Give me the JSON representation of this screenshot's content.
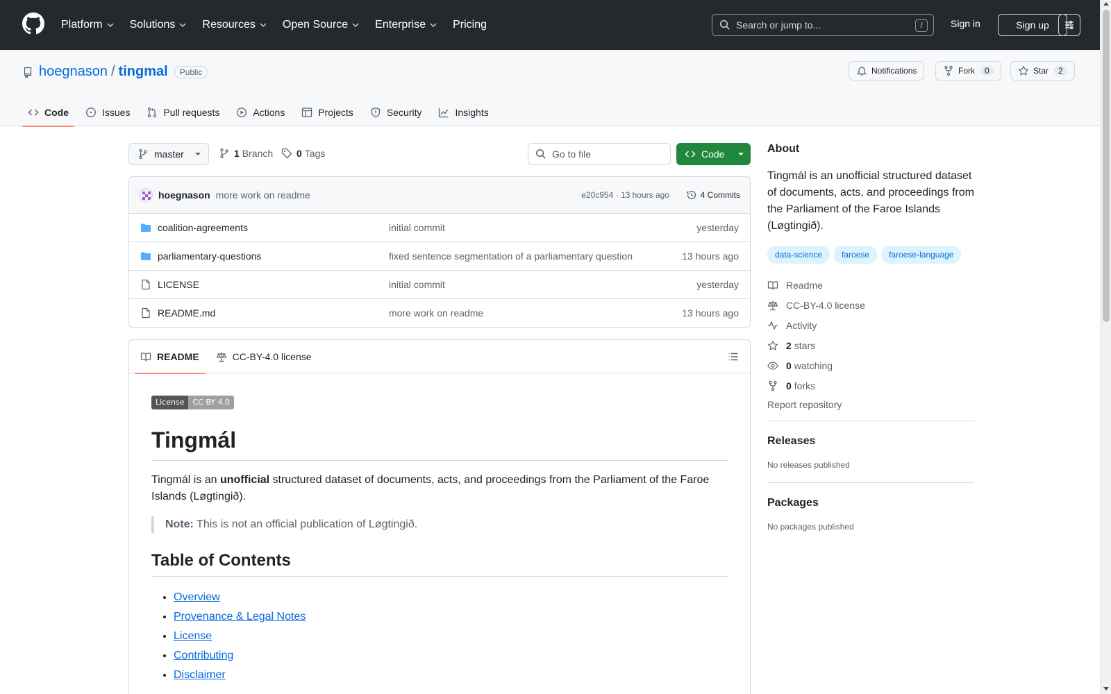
{
  "header": {
    "nav": [
      "Platform",
      "Solutions",
      "Resources",
      "Open Source",
      "Enterprise",
      "Pricing"
    ],
    "search_placeholder": "Search or jump to...",
    "search_shortcut": "/",
    "sign_in": "Sign in",
    "sign_up": "Sign up"
  },
  "repo": {
    "owner": "hoegnason",
    "name": "tingmal",
    "visibility": "Public",
    "notifications_label": "Notifications",
    "fork_label": "Fork",
    "fork_count": "0",
    "star_label": "Star",
    "star_count": "2"
  },
  "tabs": [
    "Code",
    "Issues",
    "Pull requests",
    "Actions",
    "Projects",
    "Security",
    "Insights"
  ],
  "toolbar": {
    "branch": "master",
    "branch_count": "1",
    "branch_label": "Branch",
    "tag_count": "0",
    "tag_label": "Tags",
    "go_to_file": "Go to file",
    "code_button": "Code"
  },
  "commit": {
    "author": "hoegnason",
    "message": "more work on readme",
    "hash_time": "e20c954 · 13 hours ago",
    "commits": "4 Commits"
  },
  "files": [
    {
      "type": "dir",
      "name": "coalition-agreements",
      "message": "initial commit",
      "date": "yesterday"
    },
    {
      "type": "dir",
      "name": "parliamentary-questions",
      "message": "fixed sentence segmentation of a parliamentary question",
      "date": "13 hours ago"
    },
    {
      "type": "file",
      "name": "LICENSE",
      "message": "initial commit",
      "date": "yesterday"
    },
    {
      "type": "file",
      "name": "README.md",
      "message": "more work on readme",
      "date": "13 hours ago"
    }
  ],
  "readme": {
    "tab_readme": "README",
    "tab_license": "CC-BY-4.0 license",
    "badge_left": "License",
    "badge_right": "CC BY 4.0",
    "title": "Tingmál",
    "intro_1": "Tingmál is an ",
    "intro_bold": "unofficial",
    "intro_2": " structured dataset of documents, acts, and proceedings from the Parliament of the Faroe Islands (Løgtingið).",
    "note_label": "Note:",
    "note_text": " This is not an official publication of Løgtingið.",
    "toc_title": "Table of Contents",
    "toc": [
      "Overview",
      "Provenance & Legal Notes",
      "License",
      "Contributing",
      "Disclaimer"
    ]
  },
  "about": {
    "title": "About",
    "description": "Tingmál is an unofficial structured dataset of documents, acts, and proceedings from the Parliament of the Faroe Islands (Løgtingið).",
    "topics": [
      "data-science",
      "faroese",
      "faroese-language"
    ],
    "readme": "Readme",
    "license": "CC-BY-4.0 license",
    "activity": "Activity",
    "stars_count": "2",
    "stars_label": "stars",
    "watching_count": "0",
    "watching_label": "watching",
    "forks_count": "0",
    "forks_label": "forks",
    "report": "Report repository"
  },
  "releases": {
    "title": "Releases",
    "empty": "No releases published"
  },
  "packages": {
    "title": "Packages",
    "empty": "No packages published"
  },
  "colors": {
    "accent_link": "#0969da",
    "code_button": "#1f883d",
    "header_bg": "#25292e",
    "tab_underline": "#fd8c73"
  }
}
